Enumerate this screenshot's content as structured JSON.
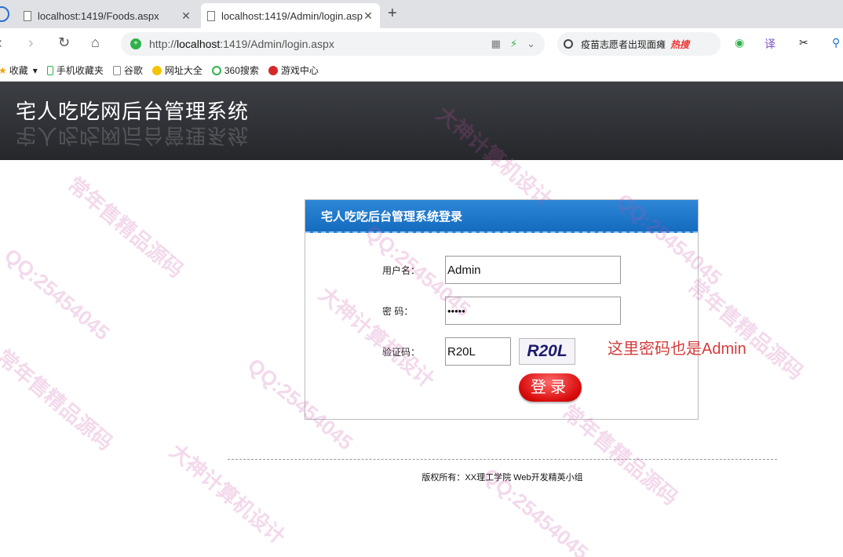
{
  "tabs": [
    {
      "title": "localhost:1419/Foods.aspx"
    },
    {
      "title": "localhost:1419/Admin/login.aspx"
    }
  ],
  "address": {
    "scheme": "http://",
    "host": "localhost",
    "rest": ":1419/Admin/login.aspx"
  },
  "search": {
    "text": "疫苗志愿者出现面瘫",
    "hot": "热搜"
  },
  "bookmarks": [
    "收藏",
    "手机收藏夹",
    "谷歌",
    "网址大全",
    "360搜索",
    "游戏中心"
  ],
  "extensions": {
    "translate": "译"
  },
  "header": {
    "title": "宅人吃吃网后台管理系统"
  },
  "login": {
    "panel_title": "宅人吃吃后台管理系统登录",
    "username_label": "用户名：",
    "username_value": "Admin",
    "password_label": "密  码：",
    "password_value": "•••••",
    "captcha_label": "验证码：",
    "captcha_value": "R20L",
    "captcha_image_text": "R20L",
    "submit_label": "登录"
  },
  "note": "这里密码也是Admin",
  "footer": "版权所有：XX理工学院 Web开发精英小组",
  "watermarks": [
    "常年售精品源码",
    "QQ:25454045",
    "大神计算机设计",
    "QQ:25454045",
    "常年售精品源码",
    "大神计算机设计",
    "QQ:25454045",
    "常年售精品源码",
    "大神计算机设计",
    "QQ:25454045",
    "常年售精品源码",
    "QQ:25454045"
  ],
  "colors": {
    "accent": "#1a73c7",
    "note": "#d43c3c",
    "header_bg": "#2e3035"
  }
}
